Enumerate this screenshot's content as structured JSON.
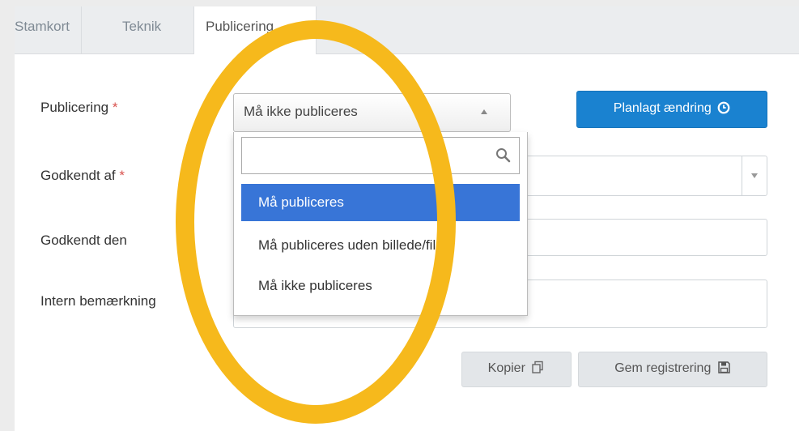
{
  "tabs": [
    {
      "label": "Stamkort"
    },
    {
      "label": "Teknik"
    },
    {
      "label": "Publicering"
    }
  ],
  "form": {
    "publicering": {
      "label": "Publicering",
      "required_mark": "*",
      "value": "Må ikke publiceres"
    },
    "godkendt_af": {
      "label": "Godkendt af",
      "required_mark": "*",
      "value": ""
    },
    "godkendt_den": {
      "label": "Godkendt den",
      "value": ""
    },
    "intern_bemaerkning": {
      "label": "Intern bemærkning",
      "value": ""
    }
  },
  "buttons": {
    "planlagt": "Planlagt ændring",
    "kopier": "Kopier",
    "gem": "Gem registrering"
  },
  "dropdown": {
    "search_value": "",
    "options": [
      {
        "label": "Må publiceres",
        "highlighted": true
      },
      {
        "label": "Må publiceres uden billede/fil",
        "highlighted": false
      },
      {
        "label": "Må ikke publiceres",
        "highlighted": false
      }
    ]
  },
  "icons": {
    "planlagt": "clock-icon",
    "kopier": "copy-icon",
    "gem": "floppy-disk-icon",
    "search": "search-icon"
  },
  "colors": {
    "primary": "#1a82d0",
    "highlight_option": "#3875d7",
    "required": "#d9534f",
    "ring": "#f6b91c"
  }
}
